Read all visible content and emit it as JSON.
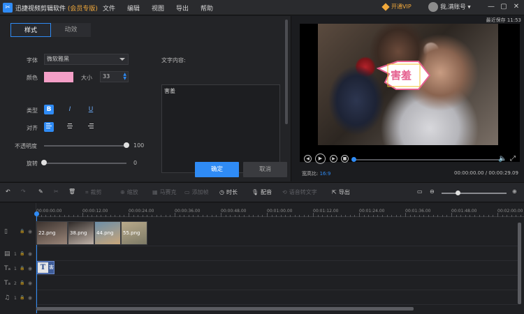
{
  "titlebar": {
    "app_name": "迅捷视频剪辑软件",
    "vip_tag": "(会员专版)",
    "menu": [
      "文件",
      "编辑",
      "视图",
      "导出",
      "帮助"
    ],
    "vip_button": "开通VIP",
    "account": "我,满账号",
    "icons": [
      "app-logo",
      "diamond-icon",
      "avatar",
      "minimize-icon",
      "restore-icon",
      "close-icon"
    ]
  },
  "editor": {
    "tabs": [
      "样式",
      "动效"
    ],
    "active_tab": "样式",
    "font_label": "字体",
    "font_value": "微软雅黑",
    "color_label": "颜色",
    "color_value": "#f49fc7",
    "size_label": "大小",
    "size_value": "33",
    "type_label": "类型",
    "type_buttons": [
      "B",
      "I",
      "U"
    ],
    "align_label": "对齐",
    "opacity_label": "不透明度",
    "opacity_value": "100",
    "opacity_level": 1.0,
    "rotate_label": "旋转",
    "rotate_value": "0",
    "rotate_level": 0.0,
    "text_content_label": "文字内容:",
    "text_content": "害羞",
    "ok_label": "确定",
    "cancel_label": "取消"
  },
  "preview": {
    "last_saved": "最近保存 11:53",
    "sticker_text": "害羞",
    "ratio_label": "宽高比:",
    "ratio_value": "16:9",
    "timecode": "00:00:00.00 / 00:00:29.09",
    "progress": 0.0
  },
  "toolbar": {
    "items": [
      {
        "label": "",
        "icon": "undo-icon",
        "enabled": true
      },
      {
        "label": "",
        "icon": "redo-icon",
        "enabled": false
      },
      {
        "label": "",
        "icon": "edit-icon",
        "enabled": true
      },
      {
        "label": "",
        "icon": "cut-icon",
        "enabled": false
      },
      {
        "label": "",
        "icon": "delete-icon",
        "enabled": true
      },
      {
        "label": "裁剪",
        "icon": "crop-icon",
        "enabled": false
      },
      {
        "label": "缩放",
        "icon": "zoom-icon",
        "enabled": false
      },
      {
        "label": "马赛克",
        "icon": "mosaic-icon",
        "enabled": false
      },
      {
        "label": "添加帧",
        "icon": "frame-icon",
        "enabled": false
      },
      {
        "label": "时长",
        "icon": "clock-icon",
        "enabled": true
      },
      {
        "label": "配音",
        "icon": "mic-icon",
        "enabled": true
      },
      {
        "label": "语音转文字",
        "icon": "speech-icon",
        "enabled": false
      },
      {
        "label": "导出",
        "icon": "export-icon",
        "enabled": true
      }
    ],
    "zoom_level": 0.25
  },
  "timeline": {
    "ruler": [
      "00:00:00.00",
      "00:00:12.00",
      "00:00:24.00",
      "00:00:36.00",
      "00:00:48.00",
      "00:01:00.00",
      "00:01:12.00",
      "00:01:24.00",
      "00:01:36.00",
      "00:01:48.00",
      "00:02:00.00"
    ],
    "tracks": [
      {
        "name": "video-track",
        "num": ""
      },
      {
        "name": "overlay-track",
        "num": "1"
      },
      {
        "name": "text-track",
        "num": "1"
      },
      {
        "name": "text-track-2",
        "num": "2"
      },
      {
        "name": "music-track",
        "num": "1"
      }
    ],
    "clips": [
      {
        "label": "22.png",
        "colors": [
          "#3d3430",
          "#9a8578"
        ]
      },
      {
        "label": "38.png",
        "colors": [
          "#2f2a28",
          "#c0b2a8"
        ]
      },
      {
        "label": "44.png",
        "colors": [
          "#6c8ea8",
          "#c9a67a"
        ]
      },
      {
        "label": "55.png",
        "colors": [
          "#b9aa8b",
          "#7d7a66"
        ]
      }
    ],
    "text_clip": {
      "icon": "T",
      "label": "害"
    }
  }
}
